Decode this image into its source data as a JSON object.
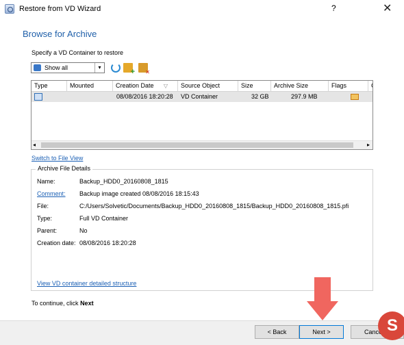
{
  "window": {
    "title": "Restore from VD Wizard",
    "help_glyph": "?",
    "close_glyph": "✕"
  },
  "header": {
    "heading": "Browse for Archive"
  },
  "container": {
    "label": "Specify a VD Container to restore",
    "filter_value": "Show all",
    "dropdown_glyph": "▾"
  },
  "table": {
    "columns": [
      "Type",
      "Mounted",
      "Creation Date",
      "Source Object",
      "Size",
      "Archive Size",
      "Flags",
      "C"
    ],
    "sort_glyph": "▽",
    "rows": [
      {
        "mounted": "",
        "creation_date": "08/08/2016 18:20:28",
        "source_object": "VD Container",
        "size": "32 GB",
        "archive_size": "297.9 MB"
      }
    ],
    "scroll_left_glyph": "◂",
    "scroll_right_glyph": "▸"
  },
  "switch_link": "Switch to File View",
  "details": {
    "legend": "Archive File Details",
    "name_label": "Name:",
    "name_value": "Backup_HDD0_20160808_1815",
    "comment_label": "Comment:",
    "comment_value": "Backup image created 08/08/2016 18:15:43",
    "file_label": "File:",
    "file_value": "C:/Users/Solvetic/Documents/Backup_HDD0_20160808_1815/Backup_HDD0_20160808_1815.pfi",
    "type_label": "Type:",
    "type_value": "Full VD Container",
    "parent_label": "Parent:",
    "parent_value": "No",
    "date_label": "Creation date:",
    "date_value": "08/08/2016 18:20:28",
    "structure_link": "View VD container detailed structure"
  },
  "continue_prefix": "To continue, click",
  "continue_target": "Next",
  "buttons": {
    "back": "< Back",
    "next": "Next >",
    "cancel": "Cancel"
  },
  "watermark": {
    "glyph": "S"
  },
  "colors": {
    "heading": "#1f5fa9",
    "link": "#1a5fb4",
    "arrow": "#f0665f"
  }
}
